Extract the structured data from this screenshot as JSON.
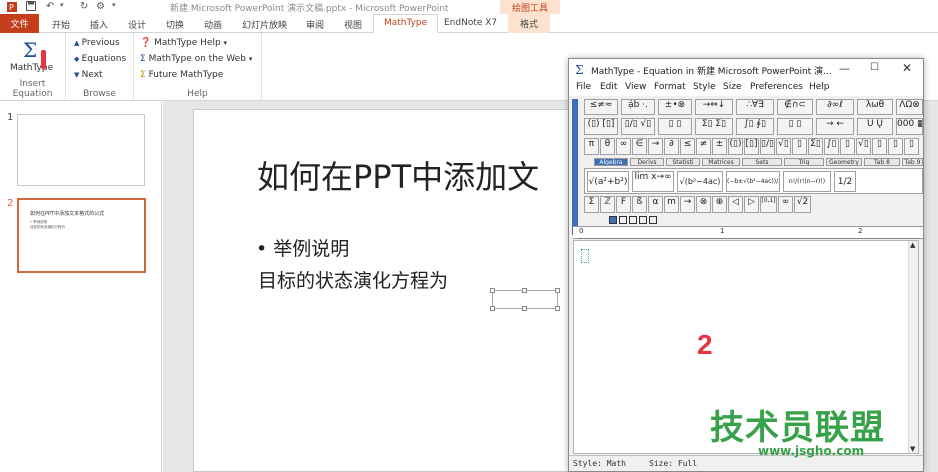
{
  "window": {
    "title": "新建 Microsoft PowerPoint 演示文稿.pptx - Microsoft PowerPoint"
  },
  "ribbon_tabs": [
    "开始",
    "插入",
    "设计",
    "切换",
    "动画",
    "幻灯片放映",
    "审阅",
    "视图"
  ],
  "file_tab": "文件",
  "mathtype_tab": "MathType",
  "endnote_tab": "EndNote X7",
  "drawing_tools": "绘图工具",
  "format_tab": "格式",
  "ribbon": {
    "insert_equation": {
      "button": "MathType",
      "label": "Insert Equation"
    },
    "browse": {
      "previous": "Previous",
      "equations": "Equations",
      "next": "Next",
      "label": "Browse"
    },
    "help": {
      "mt_help": "MathType Help",
      "on_web": "MathType on the Web",
      "future": "Future MathType",
      "label": "Help"
    }
  },
  "annotation_1": "1",
  "slides": {
    "n1": "1",
    "n2": "2",
    "thumb_title": "如何在PPT中添加文本格式的公式",
    "thumb_line1": "• 举例说明",
    "thumb_line2": "目标的状态演化方程为"
  },
  "slide": {
    "title": "如何在PPT中添加文",
    "bullet": "• 举例说明",
    "line2": "目标的状态演化方程为"
  },
  "mathtype": {
    "title": "MathType - Equation in 新建 Microsoft PowerPoint 演...",
    "menu": [
      "File",
      "Edit",
      "View",
      "Format",
      "Style",
      "Size",
      "Preferences",
      "Help"
    ],
    "row1": [
      "≤≠≈",
      "ạ̇ḃ ·.",
      "±•⊗",
      "→⇔↓",
      "∴∀∃",
      "∉∩⊂",
      "∂∞ℓ",
      "λωθ",
      "ΛΩ⊗"
    ],
    "row2": [
      "(▯) [▯]",
      "▯/▯ √▯",
      "▯ ▯",
      "Σ▯ Σ▯",
      "∫▯ ∮▯",
      "▯ ▯",
      "→ ←",
      "Ū Ų",
      "000 ▦"
    ],
    "row3": [
      "π",
      "θ",
      "∞",
      "∈",
      "→",
      "∂",
      "≤",
      "≠",
      "±",
      "(▯)",
      "[▯]",
      "▯/▯",
      "√▯",
      "▯",
      "Σ▯",
      "∫▯",
      "▯",
      "√▯",
      "▯",
      "▯",
      "▯"
    ],
    "tabs": [
      "Algebra",
      "Derivs",
      "Statisti",
      "Matrices",
      "Sets",
      "Trig",
      "Geometry",
      "Tab 8",
      "Tab 9"
    ],
    "templates": [
      "√(a²+b²)",
      "lim x→∞",
      "√(b²−4ac)",
      "(−b±√(b²−4ac))/2a",
      "n!/(r!(n−r)!)",
      "1/2"
    ],
    "row5": [
      "Σ",
      "ℤ",
      "F",
      "ß",
      "α",
      "m",
      "→",
      "⊗",
      "⊕",
      "◁",
      "▷",
      "[0,1]",
      "∞",
      "√2"
    ],
    "ruler_marks": [
      "0",
      "1",
      "2"
    ],
    "status_style": "Style: Math",
    "status_size": "Size: Full"
  },
  "annotation_2": "2",
  "watermark": {
    "text": "技术员联盟",
    "url": "www.jsgho.com"
  }
}
